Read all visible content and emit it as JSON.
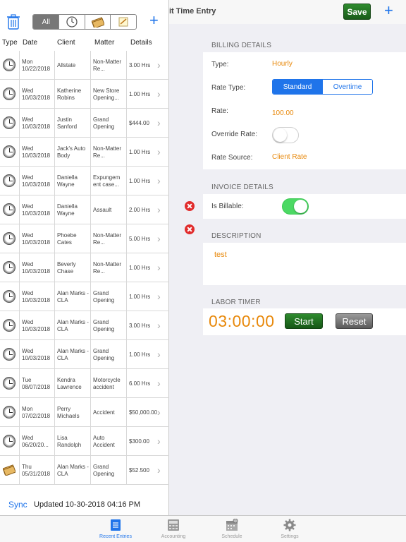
{
  "edit_pane": {
    "title": "it Time Entry",
    "save_label": "Save",
    "add_label": "+",
    "billing": {
      "header": "BILLING DETAILS",
      "type_label": "Type:",
      "type_value": "Hourly",
      "rate_type_label": "Rate Type:",
      "rate_type_options": [
        "Standard",
        "Overtime"
      ],
      "rate_type_selected": "Standard",
      "rate_label": "Rate:",
      "rate_value": "100.00",
      "override_label": "Override Rate:",
      "override_on": false,
      "source_label": "Rate Source:",
      "source_value": "Client Rate"
    },
    "invoice": {
      "header": "INVOICE DETAILS",
      "billable_label": "Is Billable:",
      "billable_on": true
    },
    "description": {
      "header": "DESCRIPTION",
      "text": "test"
    },
    "labor_timer": {
      "header": "LABOR TIMER",
      "time": "03:00:00",
      "start_label": "Start",
      "reset_label": "Reset"
    }
  },
  "list_pane": {
    "filters": [
      "All",
      "clock-icon",
      "money-icon",
      "note-icon"
    ],
    "filter_selected": "All",
    "add_label": "+",
    "columns": [
      "Type",
      "Date",
      "Client",
      "Matter",
      "Details"
    ],
    "rows": [
      {
        "type": "clock-icon",
        "day": "Mon",
        "date": "10/22/2018",
        "client": "Allstate",
        "matter": "Non-Matter Re...",
        "details": "3.00 Hrs"
      },
      {
        "type": "clock-icon",
        "day": "Wed",
        "date": "10/03/2018",
        "client": "Katherine Robins",
        "matter": "New Store Opening...",
        "details": "1.00 Hrs"
      },
      {
        "type": "clock-icon",
        "day": "Wed",
        "date": "10/03/2018",
        "client": "Justin Sanford",
        "matter": "Grand Opening",
        "details": "$444.00"
      },
      {
        "type": "clock-icon",
        "day": "Wed",
        "date": "10/03/2018",
        "client": "Jack's Auto Body",
        "matter": "Non-Matter Re...",
        "details": "1.00 Hrs"
      },
      {
        "type": "clock-icon",
        "day": "Wed",
        "date": "10/03/2018",
        "client": "Daniella Wayne",
        "matter": "Expungem ent case...",
        "details": "1.00 Hrs"
      },
      {
        "type": "clock-icon",
        "day": "Wed",
        "date": "10/03/2018",
        "client": "Daniella Wayne",
        "matter": "Assault",
        "details": "2.00 Hrs"
      },
      {
        "type": "clock-icon",
        "day": "Wed",
        "date": "10/03/2018",
        "client": "Phoebe Cates",
        "matter": "Non-Matter Re...",
        "details": "5.00 Hrs"
      },
      {
        "type": "clock-icon",
        "day": "Wed",
        "date": "10/03/2018",
        "client": "Beverly Chase",
        "matter": "Non-Matter Re...",
        "details": "1.00 Hrs"
      },
      {
        "type": "clock-icon",
        "day": "Wed",
        "date": "10/03/2018",
        "client": "Alan Marks - CLA",
        "matter": "Grand Opening",
        "details": "1.00 Hrs"
      },
      {
        "type": "clock-icon",
        "day": "Wed",
        "date": "10/03/2018",
        "client": "Alan Marks - CLA",
        "matter": "Grand Opening",
        "details": "3.00 Hrs"
      },
      {
        "type": "clock-icon",
        "day": "Wed",
        "date": "10/03/2018",
        "client": "Alan Marks - CLA",
        "matter": "Grand Opening",
        "details": "1.00 Hrs"
      },
      {
        "type": "clock-icon",
        "day": "Tue",
        "date": "08/07/2018",
        "client": "Kendra Lawrence",
        "matter": "Motorcycle accident",
        "details": "6.00 Hrs"
      },
      {
        "type": "clock-icon",
        "day": "Mon",
        "date": "07/02/2018",
        "client": "Perry Michaels",
        "matter": "Accident",
        "details": "$50,000.00"
      },
      {
        "type": "clock-icon",
        "day": "Wed",
        "date": "06/20/20...",
        "client": "Lisa Randolph",
        "matter": "Auto Accident",
        "details": "$300.00"
      },
      {
        "type": "money-icon",
        "day": "Thu",
        "date": "05/31/2018",
        "client": "Alan Marks - CLA",
        "matter": "Grand Opening",
        "details": "$52.500"
      }
    ],
    "sync_label": "Sync",
    "updated_text": "Updated 10-30-2018 04:16 PM"
  },
  "tabbar": {
    "tabs": [
      {
        "label": "Recent Entries",
        "icon": "list-icon",
        "active": true
      },
      {
        "label": "Accounting",
        "icon": "calculator-icon",
        "active": false
      },
      {
        "label": "Schedule",
        "icon": "calendar-icon",
        "active": false
      },
      {
        "label": "Settings",
        "icon": "gear-icon",
        "active": false
      }
    ]
  },
  "colors": {
    "accent": "#1f74ea",
    "orange": "#e8890c",
    "green": "#2e8b2e",
    "toggle_on": "#4cd964",
    "delete_red": "#e12c2c"
  }
}
